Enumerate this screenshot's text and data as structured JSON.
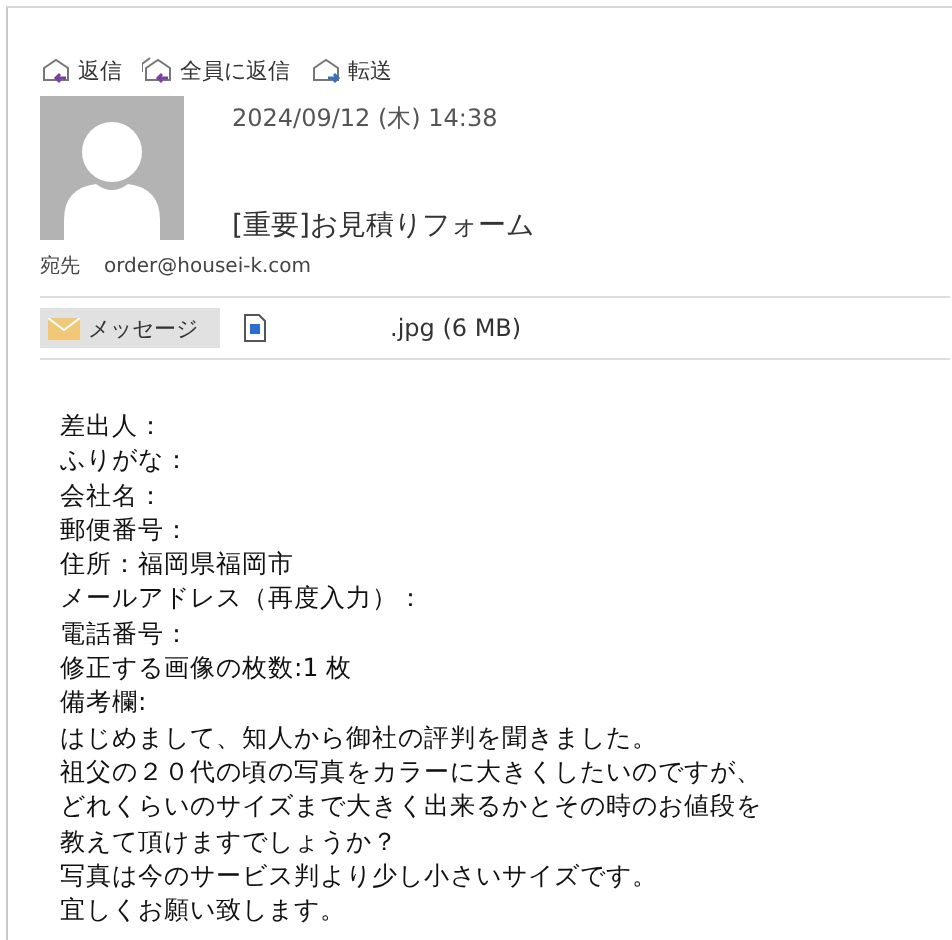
{
  "actions": [
    {
      "label": "返信",
      "kind": "reply"
    },
    {
      "label": "全員に返信",
      "kind": "reply-all"
    },
    {
      "label": "転送",
      "kind": "forward"
    }
  ],
  "header": {
    "date": "2024/09/12 (木) 14:38",
    "subject": "[重要]お見積りフォーム",
    "to_label": "宛先",
    "to": "order@housei-k.com"
  },
  "attachments": [
    {
      "kind": "message",
      "label": "メッセージ",
      "selected": true
    },
    {
      "kind": "file",
      "label": ".jpg (6 MB)",
      "selected": false
    }
  ],
  "body": [
    "差出人：",
    "ふりがな：",
    "会社名：",
    "郵便番号：",
    "住所：福岡県福岡市",
    "メールアドレス（再度入力）：",
    "電話番号：",
    "修正する画像の枚数:1 枚",
    "備考欄:",
    "はじめまして、知人から御社の評判を聞きました。",
    "祖父の２０代の頃の写真をカラーに大きくしたいのですが、",
    "どれくらいのサイズまで大きく出来るかとその時のお値段を",
    "教えて頂けますでしょうか？",
    "写真は今のサービス判より少し小さいサイズです。",
    "宜しくお願い致します。"
  ]
}
